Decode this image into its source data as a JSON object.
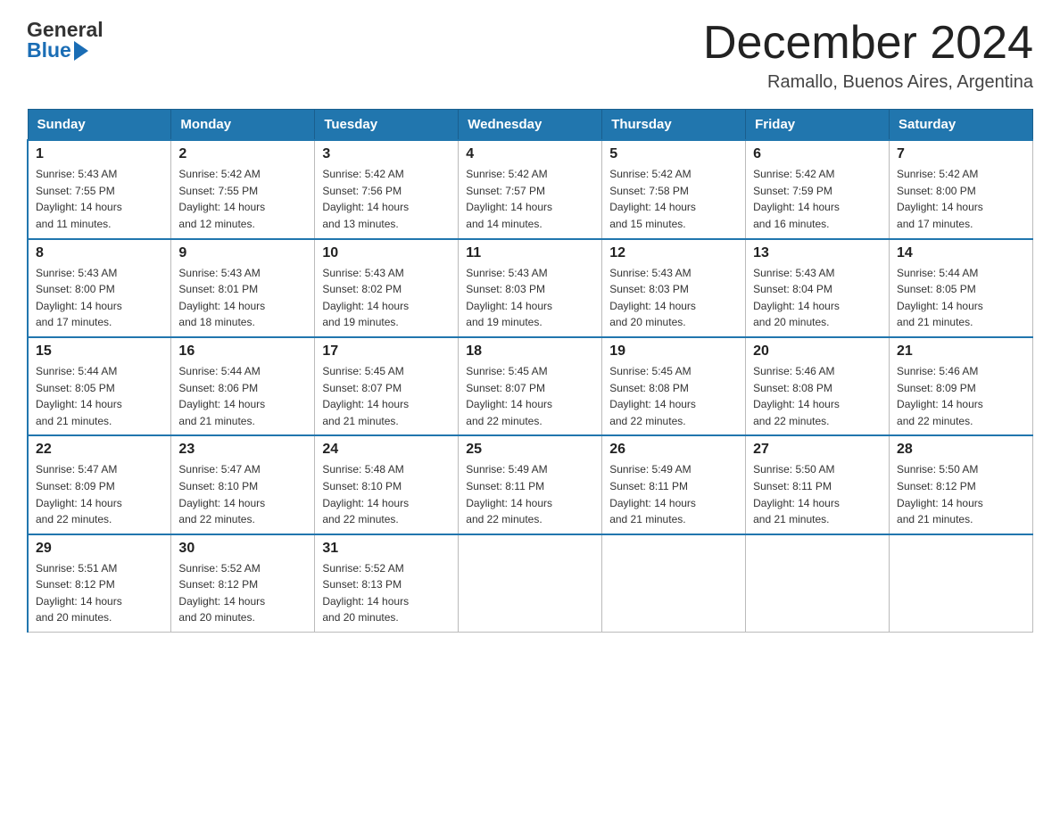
{
  "header": {
    "logo_general": "General",
    "logo_blue": "Blue",
    "month_title": "December 2024",
    "subtitle": "Ramallo, Buenos Aires, Argentina"
  },
  "days_of_week": [
    "Sunday",
    "Monday",
    "Tuesday",
    "Wednesday",
    "Thursday",
    "Friday",
    "Saturday"
  ],
  "weeks": [
    [
      {
        "day": "1",
        "sunrise": "5:43 AM",
        "sunset": "7:55 PM",
        "daylight": "14 hours and 11 minutes."
      },
      {
        "day": "2",
        "sunrise": "5:42 AM",
        "sunset": "7:55 PM",
        "daylight": "14 hours and 12 minutes."
      },
      {
        "day": "3",
        "sunrise": "5:42 AM",
        "sunset": "7:56 PM",
        "daylight": "14 hours and 13 minutes."
      },
      {
        "day": "4",
        "sunrise": "5:42 AM",
        "sunset": "7:57 PM",
        "daylight": "14 hours and 14 minutes."
      },
      {
        "day": "5",
        "sunrise": "5:42 AM",
        "sunset": "7:58 PM",
        "daylight": "14 hours and 15 minutes."
      },
      {
        "day": "6",
        "sunrise": "5:42 AM",
        "sunset": "7:59 PM",
        "daylight": "14 hours and 16 minutes."
      },
      {
        "day": "7",
        "sunrise": "5:42 AM",
        "sunset": "8:00 PM",
        "daylight": "14 hours and 17 minutes."
      }
    ],
    [
      {
        "day": "8",
        "sunrise": "5:43 AM",
        "sunset": "8:00 PM",
        "daylight": "14 hours and 17 minutes."
      },
      {
        "day": "9",
        "sunrise": "5:43 AM",
        "sunset": "8:01 PM",
        "daylight": "14 hours and 18 minutes."
      },
      {
        "day": "10",
        "sunrise": "5:43 AM",
        "sunset": "8:02 PM",
        "daylight": "14 hours and 19 minutes."
      },
      {
        "day": "11",
        "sunrise": "5:43 AM",
        "sunset": "8:03 PM",
        "daylight": "14 hours and 19 minutes."
      },
      {
        "day": "12",
        "sunrise": "5:43 AM",
        "sunset": "8:03 PM",
        "daylight": "14 hours and 20 minutes."
      },
      {
        "day": "13",
        "sunrise": "5:43 AM",
        "sunset": "8:04 PM",
        "daylight": "14 hours and 20 minutes."
      },
      {
        "day": "14",
        "sunrise": "5:44 AM",
        "sunset": "8:05 PM",
        "daylight": "14 hours and 21 minutes."
      }
    ],
    [
      {
        "day": "15",
        "sunrise": "5:44 AM",
        "sunset": "8:05 PM",
        "daylight": "14 hours and 21 minutes."
      },
      {
        "day": "16",
        "sunrise": "5:44 AM",
        "sunset": "8:06 PM",
        "daylight": "14 hours and 21 minutes."
      },
      {
        "day": "17",
        "sunrise": "5:45 AM",
        "sunset": "8:07 PM",
        "daylight": "14 hours and 21 minutes."
      },
      {
        "day": "18",
        "sunrise": "5:45 AM",
        "sunset": "8:07 PM",
        "daylight": "14 hours and 22 minutes."
      },
      {
        "day": "19",
        "sunrise": "5:45 AM",
        "sunset": "8:08 PM",
        "daylight": "14 hours and 22 minutes."
      },
      {
        "day": "20",
        "sunrise": "5:46 AM",
        "sunset": "8:08 PM",
        "daylight": "14 hours and 22 minutes."
      },
      {
        "day": "21",
        "sunrise": "5:46 AM",
        "sunset": "8:09 PM",
        "daylight": "14 hours and 22 minutes."
      }
    ],
    [
      {
        "day": "22",
        "sunrise": "5:47 AM",
        "sunset": "8:09 PM",
        "daylight": "14 hours and 22 minutes."
      },
      {
        "day": "23",
        "sunrise": "5:47 AM",
        "sunset": "8:10 PM",
        "daylight": "14 hours and 22 minutes."
      },
      {
        "day": "24",
        "sunrise": "5:48 AM",
        "sunset": "8:10 PM",
        "daylight": "14 hours and 22 minutes."
      },
      {
        "day": "25",
        "sunrise": "5:49 AM",
        "sunset": "8:11 PM",
        "daylight": "14 hours and 22 minutes."
      },
      {
        "day": "26",
        "sunrise": "5:49 AM",
        "sunset": "8:11 PM",
        "daylight": "14 hours and 21 minutes."
      },
      {
        "day": "27",
        "sunrise": "5:50 AM",
        "sunset": "8:11 PM",
        "daylight": "14 hours and 21 minutes."
      },
      {
        "day": "28",
        "sunrise": "5:50 AM",
        "sunset": "8:12 PM",
        "daylight": "14 hours and 21 minutes."
      }
    ],
    [
      {
        "day": "29",
        "sunrise": "5:51 AM",
        "sunset": "8:12 PM",
        "daylight": "14 hours and 20 minutes."
      },
      {
        "day": "30",
        "sunrise": "5:52 AM",
        "sunset": "8:12 PM",
        "daylight": "14 hours and 20 minutes."
      },
      {
        "day": "31",
        "sunrise": "5:52 AM",
        "sunset": "8:13 PM",
        "daylight": "14 hours and 20 minutes."
      },
      null,
      null,
      null,
      null
    ]
  ],
  "labels": {
    "sunrise": "Sunrise:",
    "sunset": "Sunset:",
    "daylight": "Daylight:"
  }
}
